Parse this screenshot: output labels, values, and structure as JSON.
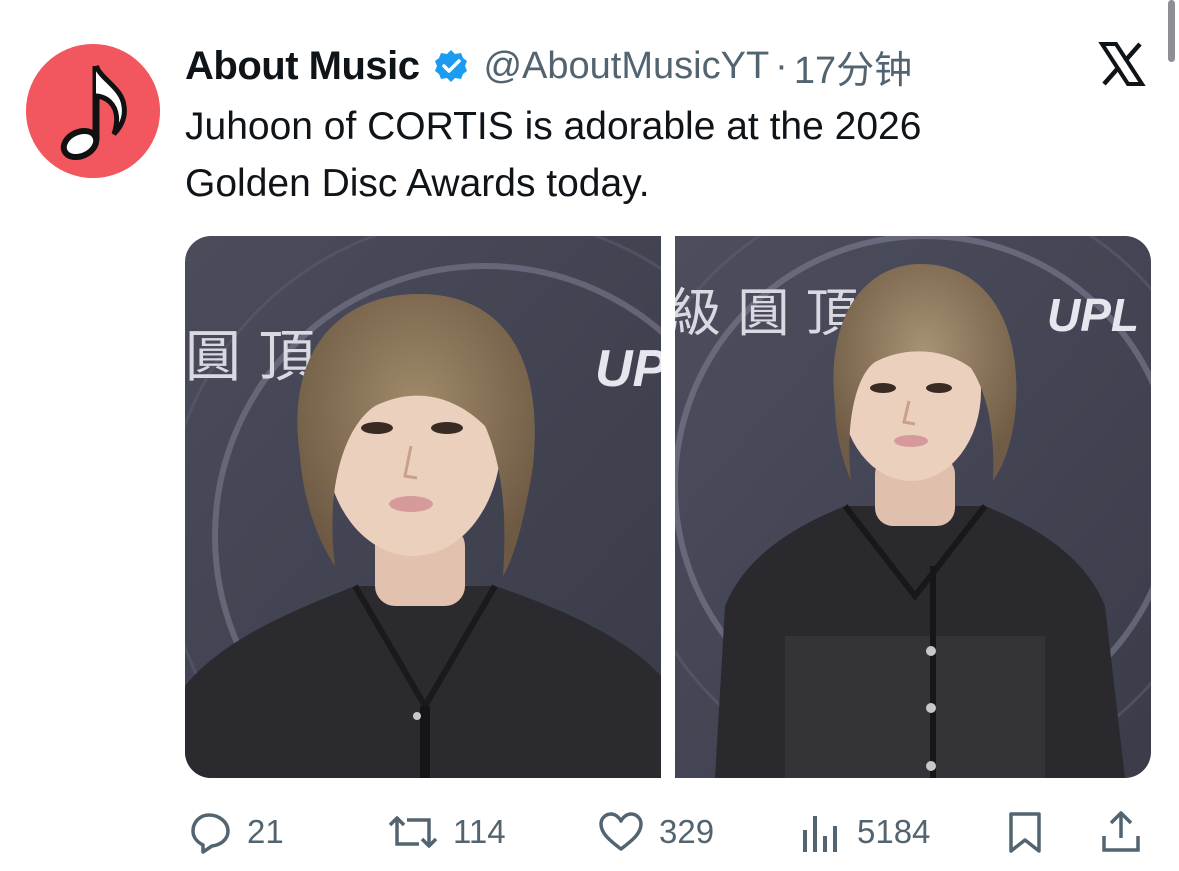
{
  "tweet": {
    "display_name": "About Music",
    "verified": true,
    "handle": "@AboutMusicYT",
    "separator": "·",
    "time": "17分钟",
    "text_lines": [
      "Juhoon of CORTIS is adorable at the 2026",
      "Golden Disc Awards today."
    ],
    "media": [
      {
        "kind": "photo",
        "background_text": "圓 頂",
        "logo_text": "UP"
      },
      {
        "kind": "photo",
        "background_text": "級 圓 頂",
        "logo_text": "UPL"
      }
    ]
  },
  "actions": {
    "reply": {
      "icon": "reply-icon",
      "count": "21"
    },
    "retweet": {
      "icon": "retweet-icon",
      "count": "114"
    },
    "like": {
      "icon": "heart-icon",
      "count": "329"
    },
    "views": {
      "icon": "views-icon",
      "count": "5184"
    },
    "bookmark": {
      "icon": "bookmark-icon"
    },
    "share": {
      "icon": "share-icon"
    }
  },
  "colors": {
    "avatar_bg": "#f2575f",
    "verified": "#1d9bf0",
    "text": "#0f1419",
    "muted": "#536471"
  },
  "icons": {
    "avatar": "music-note-icon",
    "platform": "x-logo-icon"
  }
}
